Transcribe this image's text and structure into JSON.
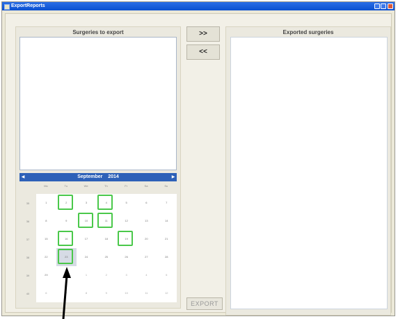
{
  "window": {
    "title": "ExportReports"
  },
  "left_panel": {
    "title": "Surgeries to export"
  },
  "right_panel": {
    "title": "Exported surgeries"
  },
  "buttons": {
    "add": ">>",
    "remove": "<<",
    "export": "EXPORT"
  },
  "calendar": {
    "month": "September",
    "year": "2014",
    "day_names": [
      "Mo",
      "Tu",
      "We",
      "Th",
      "Fr",
      "Sa",
      "Su"
    ],
    "weeks": [
      {
        "no": "35",
        "days": [
          {
            "d": "1"
          },
          {
            "d": "2",
            "hl": true
          },
          {
            "d": "3"
          },
          {
            "d": "4",
            "hl": true
          },
          {
            "d": "5"
          },
          {
            "d": "6"
          },
          {
            "d": "7"
          }
        ]
      },
      {
        "no": "36",
        "days": [
          {
            "d": "8"
          },
          {
            "d": "9"
          },
          {
            "d": "10",
            "hl": true
          },
          {
            "d": "11",
            "hl": true
          },
          {
            "d": "12"
          },
          {
            "d": "13"
          },
          {
            "d": "14"
          }
        ]
      },
      {
        "no": "37",
        "days": [
          {
            "d": "15"
          },
          {
            "d": "16",
            "hl": true
          },
          {
            "d": "17"
          },
          {
            "d": "18"
          },
          {
            "d": "19",
            "hl": true
          },
          {
            "d": "20"
          },
          {
            "d": "21"
          }
        ]
      },
      {
        "no": "38",
        "days": [
          {
            "d": "22"
          },
          {
            "d": "23",
            "hl": true,
            "today": true
          },
          {
            "d": "24"
          },
          {
            "d": "25"
          },
          {
            "d": "26"
          },
          {
            "d": "27"
          },
          {
            "d": "28"
          }
        ]
      },
      {
        "no": "39",
        "days": [
          {
            "d": "29"
          },
          {
            "d": "30"
          },
          {
            "d": "1",
            "other": true
          },
          {
            "d": "2",
            "other": true
          },
          {
            "d": "3",
            "other": true
          },
          {
            "d": "4",
            "other": true
          },
          {
            "d": "5",
            "other": true
          }
        ]
      },
      {
        "no": "40",
        "days": [
          {
            "d": "6",
            "other": true
          },
          {
            "d": "7",
            "other": true
          },
          {
            "d": "8",
            "other": true
          },
          {
            "d": "9",
            "other": true
          },
          {
            "d": "10",
            "other": true
          },
          {
            "d": "11",
            "other": true
          },
          {
            "d": "12",
            "other": true
          }
        ]
      }
    ]
  },
  "colors": {
    "highlight": "#4ac84a",
    "calendar_header": "#2d61b8"
  }
}
